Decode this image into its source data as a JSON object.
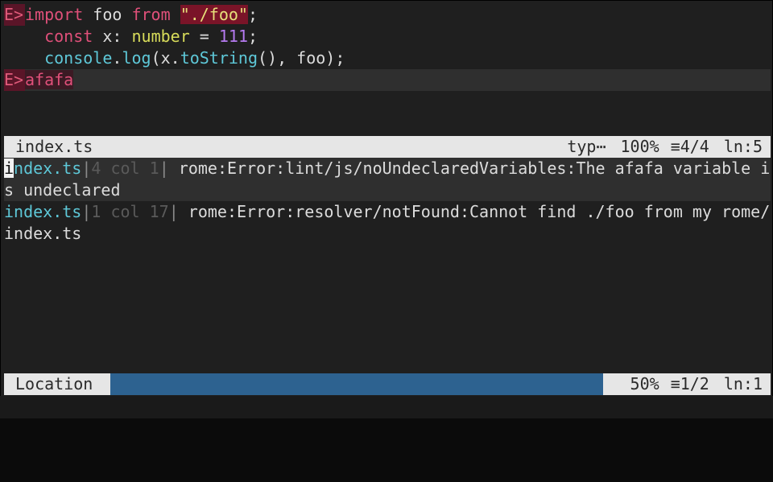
{
  "editor": {
    "error_sign": "E>",
    "lines": [
      {
        "kw1": "import",
        "t1": " foo ",
        "kw2": "from",
        "t2": " ",
        "str": "\"./foo\"",
        "t3": ";"
      },
      {
        "indent": "  ",
        "kw": "const",
        "t1": " x: ",
        "type": "number",
        "t2": " = ",
        "num": "111",
        "t3": ";"
      },
      {
        "indent": "  ",
        "id1": "console",
        "t1": ".",
        "id2": "log",
        "t2": "(x.",
        "id3": "toString",
        "t3": "(), foo);"
      },
      {
        "text": "afafa"
      }
    ]
  },
  "status_top": {
    "filename": "index.ts",
    "filetype": "typ⋯",
    "percent": "100%",
    "position": "≡4/4",
    "line": "ln:5"
  },
  "loclist": [
    {
      "cursor_char": "i",
      "file": "ndex.ts",
      "sep1": "|",
      "pos": "4 col 1",
      "sep2": "|",
      "msg": " rome:Error:lint/js/noUndeclaredVariables:The afafa variable is undeclared"
    },
    {
      "file": "index.ts",
      "sep1": "|",
      "pos": "1 col 17",
      "sep2": "|",
      "msg": " rome:Error:resolver/notFound:Cannot find ./foo from my rome/index.ts"
    }
  ],
  "status_bottom": {
    "title": "Location",
    "percent": "50%",
    "position": "≡1/2",
    "line": "ln:1"
  },
  "colors": {
    "accent_blue": "#2d6290",
    "error": "#e0507a"
  }
}
